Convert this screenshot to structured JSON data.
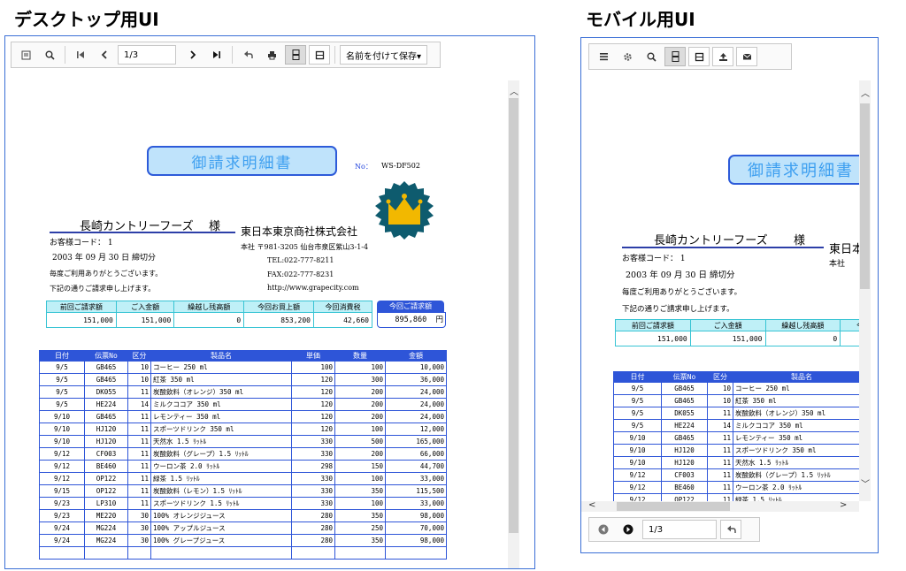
{
  "headings": {
    "desktop": "デスクトップ用UI",
    "mobile": "モバイル用UI"
  },
  "desktop_toolbar": {
    "page_value": "1/3",
    "save_label": "名前を付けて保存▾"
  },
  "mobile_footer": {
    "page_value": "1/3"
  },
  "report": {
    "title": "御請求明細書",
    "no_label": "No：",
    "no_value": "WS-DF502",
    "customer": "長崎カントリーフーズ",
    "sama": "様",
    "customer_code": "お客様コード：  1",
    "closing": "2003  年  09  月  30  日  締切分",
    "greeting1": "毎度ご利用ありがとうございます。",
    "greeting2": "下記の通りご請求申し上げます。",
    "company": "東日本東京商社株式会社",
    "address": "本社   〒981-3205  仙台市泉区紫山3-1-4",
    "tel": "TEL:022-777-8211",
    "fax": "FAX:022-777-8231",
    "url": "http://www.grapecity.com",
    "summary_headers": [
      "前回ご請求額",
      "ご入金額",
      "繰越し残高額",
      "今回お買上額",
      "今回消費税"
    ],
    "summary_values": [
      "151,000",
      "151,000",
      "0",
      "853,200",
      "42,660"
    ],
    "current_label": "今回ご請求額",
    "current_value": "895,860",
    "current_unit": "円",
    "detail_headers": [
      "日付",
      "伝票No",
      "区分",
      "製品名",
      "単価",
      "数量",
      "金額"
    ],
    "rows": [
      [
        "9/5",
        "GB465",
        "10",
        "コーヒー 250 ml",
        "100",
        "100",
        "10,000"
      ],
      [
        "9/5",
        "GB465",
        "10",
        "紅茶 350 ml",
        "120",
        "300",
        "36,000"
      ],
      [
        "9/5",
        "DK055",
        "11",
        "炭酸飲料（オレンジ）350 ml",
        "120",
        "200",
        "24,000"
      ],
      [
        "9/5",
        "HE224",
        "14",
        "ミルクココア 350 ml",
        "120",
        "200",
        "24,000"
      ],
      [
        "9/10",
        "GB465",
        "11",
        "レモンティー 350 ml",
        "120",
        "200",
        "24,000"
      ],
      [
        "9/10",
        "HJ120",
        "11",
        "スポーツドリンク 350 ml",
        "120",
        "100",
        "12,000"
      ],
      [
        "9/10",
        "HJ120",
        "11",
        "天然水 1.5 ﾘｯﾄﾙ",
        "330",
        "500",
        "165,000"
      ],
      [
        "9/12",
        "CF003",
        "11",
        "炭酸飲料（グレープ）1.5 ﾘｯﾄﾙ",
        "330",
        "200",
        "66,000"
      ],
      [
        "9/12",
        "BE460",
        "11",
        "ウーロン茶 2.0 ﾘｯﾄﾙ",
        "298",
        "150",
        "44,700"
      ],
      [
        "9/12",
        "OP122",
        "11",
        "緑茶 1.5 ﾘｯﾄﾙ",
        "330",
        "100",
        "33,000"
      ],
      [
        "9/15",
        "OP122",
        "11",
        "炭酸飲料（レモン）1.5 ﾘｯﾄﾙ",
        "330",
        "350",
        "115,500"
      ],
      [
        "9/23",
        "LP310",
        "11",
        "スポーツドリンク 1.5 ﾘｯﾄﾙ",
        "330",
        "100",
        "33,000"
      ],
      [
        "9/23",
        "ME220",
        "30",
        "100% オレンジジュース",
        "280",
        "350",
        "98,000"
      ],
      [
        "9/24",
        "MG224",
        "30",
        "100% アップルジュース",
        "280",
        "250",
        "70,000"
      ],
      [
        "9/24",
        "MG224",
        "30",
        "100% グレープジュース",
        "280",
        "350",
        "98,000"
      ]
    ]
  },
  "colors": {
    "frame_border": "#3b6fd6",
    "title_fill": "#bfe3fb",
    "table_header": "#2e55d8",
    "summary_header": "#bff0f7"
  },
  "icons": [
    "toggle-sidebar-icon",
    "search-icon",
    "first-page-icon",
    "prev-page-icon",
    "next-page-icon",
    "last-page-icon",
    "back-icon",
    "print-icon",
    "continuous-view-icon",
    "single-page-icon",
    "hamburger-menu-icon",
    "gear-icon",
    "export-icon",
    "email-icon",
    "prev-circle-icon",
    "next-circle-icon"
  ]
}
